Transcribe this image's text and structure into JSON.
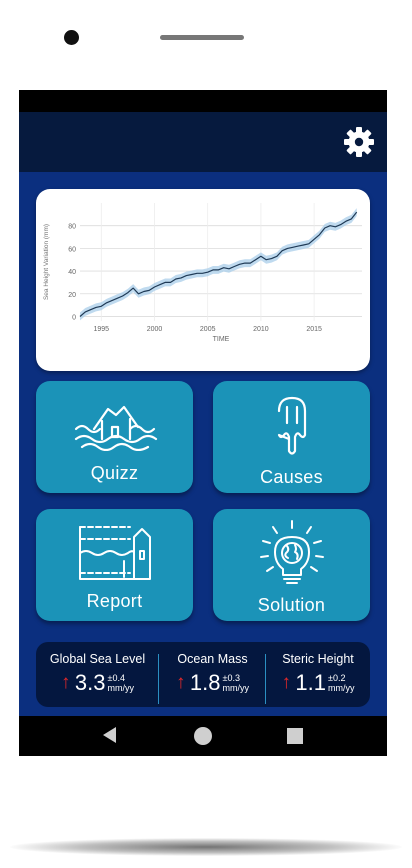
{
  "chart_data": {
    "type": "line",
    "title": "",
    "xlabel": "TIME",
    "ylabel": "Sea Height Variation (mm)",
    "x_ticks": [
      "1995",
      "2000",
      "2005",
      "2010",
      "2015"
    ],
    "y_ticks": [
      "0",
      "20",
      "40",
      "60",
      "80"
    ],
    "xlim": [
      1993,
      2019.5
    ],
    "ylim": [
      -4,
      100
    ],
    "grid": true,
    "line_color": "#1f3a56",
    "band_color": "#a9cdea",
    "series": [
      {
        "x": [
          1993.0,
          1993.5,
          1994.0,
          1994.5,
          1995.0,
          1995.5,
          1996.0,
          1996.5,
          1997.0,
          1997.5,
          1998.0,
          1998.5,
          1999.0,
          1999.5,
          2000.0,
          2000.5,
          2001.0,
          2001.5,
          2002.0,
          2002.5,
          2003.0,
          2003.5,
          2004.0,
          2004.5,
          2005.0,
          2005.5,
          2006.0,
          2006.5,
          2007.0,
          2007.5,
          2008.0,
          2008.5,
          2009.0,
          2009.5,
          2010.0,
          2010.5,
          2011.0,
          2011.5,
          2012.0,
          2012.5,
          2013.0,
          2013.5,
          2014.0,
          2014.5,
          2015.0,
          2015.5,
          2016.0,
          2016.5,
          2017.0,
          2017.5,
          2018.0,
          2018.5,
          2019.0
        ],
        "y": [
          0,
          4,
          6,
          8,
          9,
          12,
          14,
          16,
          18,
          21,
          25,
          20,
          22,
          23,
          26,
          28,
          30,
          30,
          33,
          34,
          36,
          37,
          38,
          38,
          39,
          41,
          41,
          43,
          42,
          44,
          46,
          47,
          47,
          50,
          53,
          50,
          51,
          53,
          58,
          60,
          61,
          62,
          63,
          64,
          68,
          72,
          78,
          80,
          79,
          81,
          84,
          86,
          92
        ]
      }
    ]
  },
  "tiles": {
    "quizz": "Quizz",
    "causes": "Causes",
    "report": "Report",
    "solution": "Solution"
  },
  "stats": [
    {
      "title": "Global Sea Level",
      "value": "3.3",
      "uncertainty": "±0.4",
      "unit": "mm/yy"
    },
    {
      "title": "Ocean Mass",
      "value": "1.8",
      "uncertainty": "±0.3",
      "unit": "mm/yy"
    },
    {
      "title": "Steric Height",
      "value": "1.1",
      "uncertainty": "±0.2",
      "unit": "mm/yy"
    }
  ],
  "icons": {
    "settings": "gear-icon",
    "quizz": "flooded-house-icon",
    "causes": "melting-popsicle-icon",
    "report": "flood-level-building-icon",
    "solution": "globe-lightbulb-icon",
    "trend": "arrow-up-icon"
  },
  "colors": {
    "app_bar": "#061a3e",
    "background": "#0b2f7f",
    "tile": "#1b93b8",
    "stats_panel": "#04173f",
    "trend_arrow": "#e2282a"
  }
}
